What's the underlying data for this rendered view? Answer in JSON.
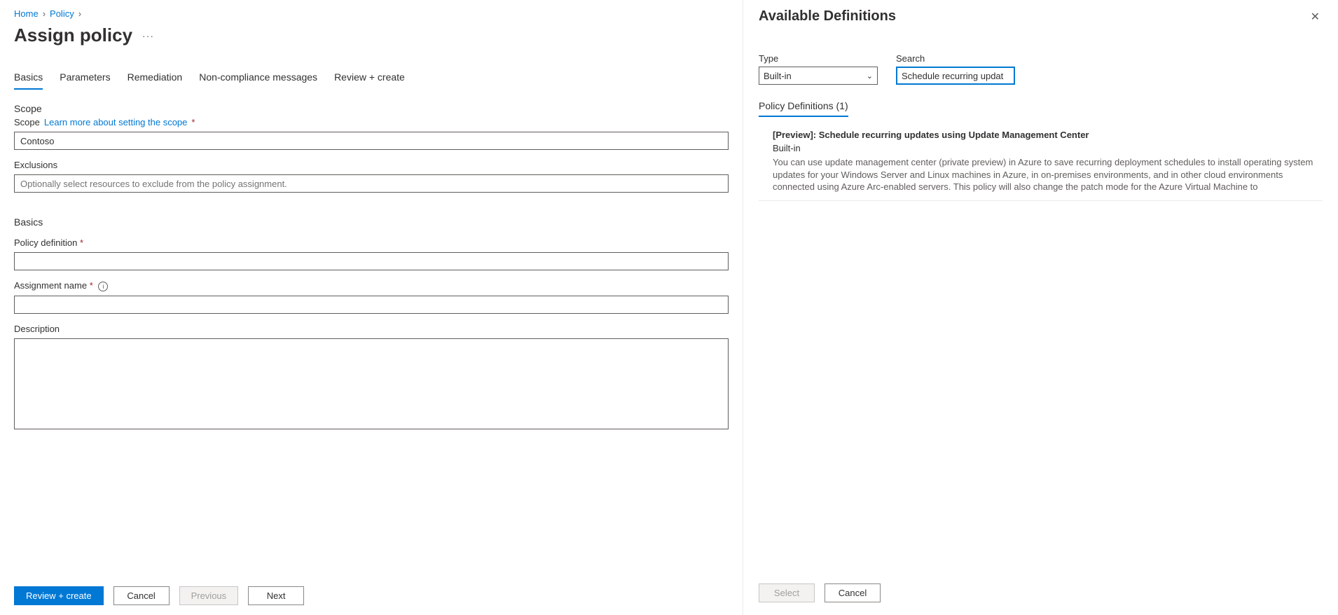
{
  "breadcrumb": {
    "home": "Home",
    "policy": "Policy"
  },
  "page": {
    "title": "Assign policy"
  },
  "tabs": {
    "basics": "Basics",
    "parameters": "Parameters",
    "remediation": "Remediation",
    "noncompliance": "Non-compliance messages",
    "review": "Review + create"
  },
  "scope": {
    "heading": "Scope",
    "label": "Scope",
    "learn": "Learn more about setting the scope",
    "value": "Contoso",
    "exclusions_label": "Exclusions",
    "exclusions_placeholder": "Optionally select resources to exclude from the policy assignment."
  },
  "basics": {
    "heading": "Basics",
    "policy_def_label": "Policy definition",
    "assignment_name_label": "Assignment name",
    "description_label": "Description"
  },
  "footer": {
    "review": "Review + create",
    "cancel": "Cancel",
    "previous": "Previous",
    "next": "Next"
  },
  "panel": {
    "title": "Available Definitions",
    "type_label": "Type",
    "type_value": "Built-in",
    "search_label": "Search",
    "search_value": "Schedule recurring updat",
    "list_tab": "Policy Definitions (1)",
    "result": {
      "title": "[Preview]: Schedule recurring updates using Update Management Center",
      "type": "Built-in",
      "desc": "You can use update management center (private preview) in Azure to save recurring deployment schedules to install operating system updates for your Windows Server and Linux machines in Azure, in on-premises environments, and in other cloud environments connected using Azure Arc-enabled servers. This policy will also change the patch mode for the Azure Virtual Machine to"
    },
    "footer": {
      "select": "Select",
      "cancel": "Cancel"
    }
  }
}
